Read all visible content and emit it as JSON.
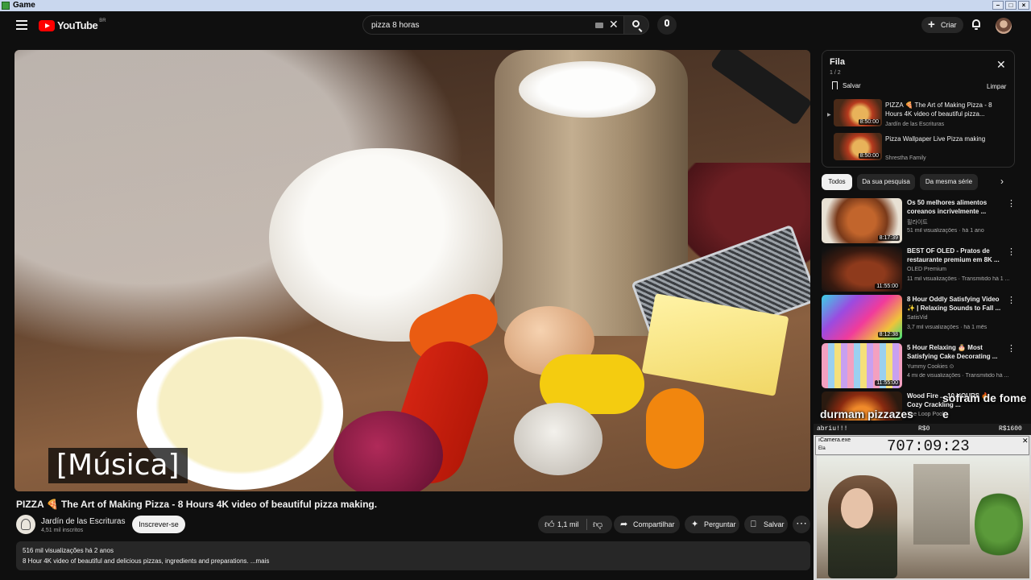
{
  "window": {
    "title": "Game"
  },
  "header": {
    "logo_text": "YouTube",
    "country_code": "BR",
    "search_value": "pizza 8 horas",
    "create_label": "Criar"
  },
  "player": {
    "caption": "[Música]"
  },
  "video": {
    "title": "PIZZA 🍕 The Art of Making Pizza - 8 Hours 4K video of beautiful pizza making.",
    "channel": "Jardín de las Escrituras",
    "subscribers": "4,51 mil inscritos",
    "subscribe_label": "Inscrever-se",
    "likes": "1,1 mil",
    "share_label": "Compartilhar",
    "ask_label": "Perguntar",
    "save_label": "Salvar",
    "views_date": "516 mil visualizações  há 2 anos",
    "description": "8 Hour 4K video of beautiful and delicious pizzas, ingredients and preparations. ...mais"
  },
  "queue": {
    "title": "Fila",
    "count": "1 / 2",
    "save_label": "Salvar",
    "clear_label": "Limpar",
    "items": [
      {
        "title": "PIZZA 🍕 The Art of Making Pizza - 8 Hours 4K video of beautiful pizza...",
        "channel": "Jardín de las Escrituras",
        "duration": "8:50:00"
      },
      {
        "title": "Pizza Wallpaper Live Pizza making",
        "channel": "Shrestha Family",
        "duration": "8:50:00"
      }
    ]
  },
  "filters": [
    "Todos",
    "Da sua pesquisa",
    "Da mesma série"
  ],
  "recommendations": [
    {
      "title": "Os 50 melhores alimentos coreanos incrivelmente ...",
      "channel": "필라이트",
      "meta": "51 mil visualizações · há 1 ano",
      "duration": "8:17:39"
    },
    {
      "title": "BEST OF OLED - Pratos de restaurante premium em 8K ...",
      "channel": "OLED Premium",
      "meta": "11 mil visualizações · Transmitido há 1 ...",
      "duration": "11:55:00"
    },
    {
      "title": "8 Hour Oddly Satisfying Video ✨ | Relaxing Sounds to Fall ...",
      "channel": "SatisVid",
      "meta": "3,7 mil visualizações · há 1 mês",
      "duration": "8:12:38"
    },
    {
      "title": "5 Hour Relaxing 🎂 Most Satisfying Cake Decorating ...",
      "channel": "Yummy Cookies ⊙",
      "meta": "4 mi de visualizações · Transmitido há ...",
      "duration": "11:55:00"
    },
    {
      "title": "Wood Fire ... 10 HOURS 🔥 Cozy Crackling ...",
      "channel": "The Loop Pool",
      "meta": "",
      "duration": ""
    }
  ],
  "stream_overlay": {
    "text_right": "sofram de fome e",
    "text_left": "durmam pizzazes",
    "status_left": "abriu!!!",
    "status_mid": "R$0",
    "status_right": "R$1600",
    "window_title": "ıCamera.exe",
    "window_sub": "Ela",
    "timer": "707:09:23"
  },
  "colors": {
    "background": "#0f0f0f",
    "accent": "#ff0000",
    "chip_active": "#f1f1f1"
  }
}
